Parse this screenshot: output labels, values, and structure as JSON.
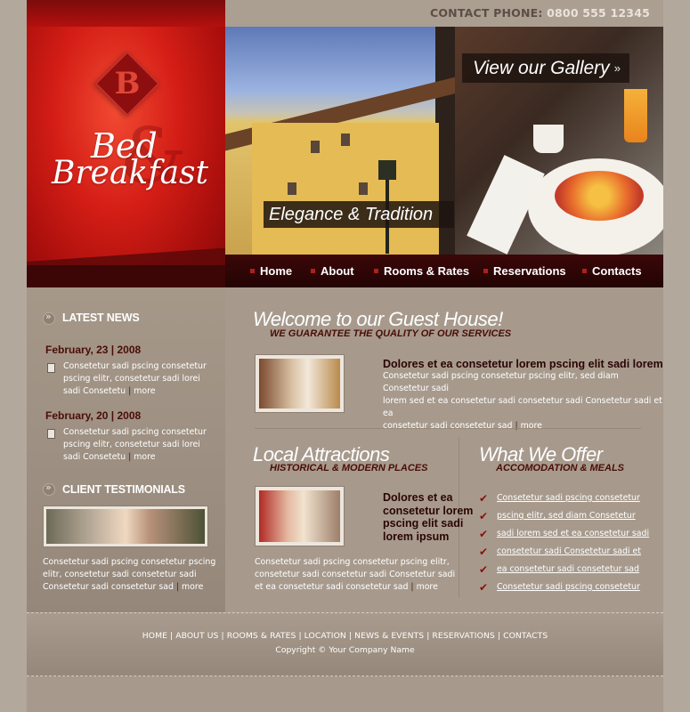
{
  "header": {
    "phone_label": "CONTACT PHONE:",
    "phone_number": "0800 555 12345"
  },
  "logo": {
    "mark": "B",
    "word1": "Bed",
    "word2": "Breakfast"
  },
  "hero": {
    "gallery_label": "View our Gallery",
    "tagline": "Elegance & Tradition"
  },
  "nav": {
    "items": [
      "Home",
      "About",
      "Rooms & Rates",
      "Reservations",
      "Contacts"
    ]
  },
  "sidebar": {
    "news_heading": "LATEST NEWS",
    "news": [
      {
        "date": "February, 23  |  2008",
        "text_l1": "Consetetur sadi pscing consetetur",
        "text_l2": "pscing elitr, consetetur sadi lorei",
        "text_l3": "sadi Consetetu",
        "more": "more"
      },
      {
        "date": "February, 20  |  2008",
        "text_l1": "Consetetur sadi pscing consetetur",
        "text_l2": "pscing elitr, consetetur sadi lorei",
        "text_l3": "sadi Consetetu",
        "more": "more"
      }
    ],
    "testimonials_heading": "CLIENT TESTIMONIALS",
    "testimonial_l1": "Consetetur sadi pscing consetetur pscing",
    "testimonial_l2": "elitr, consetetur sadi consetetur sadi",
    "testimonial_l3": "Consetetur sadi consetetur sad",
    "testimonial_more": "more"
  },
  "welcome": {
    "title": "Welcome to our Guest House!",
    "subtitle": "WE GUARANTEE THE QUALITY OF OUR SERVICES",
    "item_title": "Dolores et ea consetetur lorem pscing elit sadi lorem",
    "item_l1": "Consetetur sadi pscing consetetur pscing elitr, sed diam Consetetur sadi",
    "item_l2": "lorem sed  et ea consetetur sadi consetetur sadi Consetetur sadi  et ea",
    "item_l3": "consetetur sadi consetetur sad",
    "item_more": "more"
  },
  "attractions": {
    "title": "Local Attractions",
    "subtitle": "HISTORICAL & MODERN PLACES",
    "item_title_l1": "Dolores et ea",
    "item_title_l2": "consetetur lorem",
    "item_title_l3": "pscing elit sadi",
    "item_title_l4": "lorem ipsum",
    "text_l1": "Consetetur sadi pscing consetetur pscing elitr,",
    "text_l2": "consetetur sadi consetetur sadi Consetetur sadi",
    "text_l3": "et ea consetetur sadi consetetur sad",
    "more": "more"
  },
  "offer": {
    "title": "What We Offer",
    "subtitle": "ACCOMODATION & MEALS",
    "items": [
      "Consetetur sadi pscing consetetur ",
      "pscing elitr, sed diam Consetetur ",
      "sadi lorem sed  et ea consetetur sadi",
      "consetetur sadi Consetetur sadi  et",
      "ea consetetur sadi consetetur sad ",
      "Consetetur sadi pscing consetetur "
    ]
  },
  "footer": {
    "links": [
      "HOME",
      "ABOUT US",
      "ROOMS & RATES",
      "LOCATION",
      "NEWS & EVENTS",
      "RESERVATIONS",
      "CONTACTS"
    ],
    "copyright": "Copyright © Your Company Name"
  },
  "colors": {
    "brand_red": "#d41e16",
    "dark_maroon": "#2a0503",
    "background": "#a79a8d"
  }
}
